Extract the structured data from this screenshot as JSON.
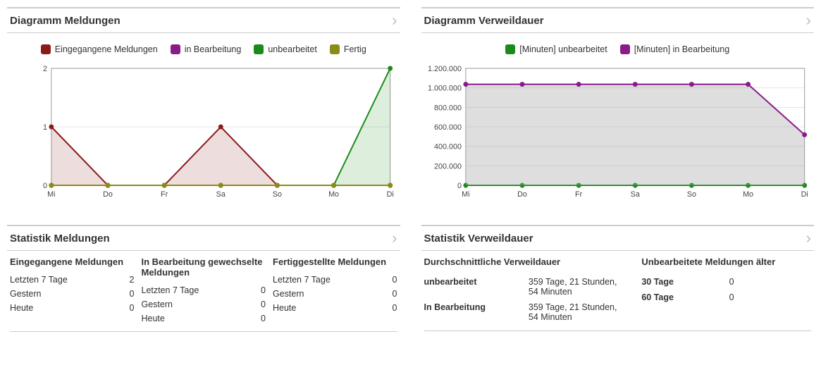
{
  "panels": {
    "chart_meldungen": {
      "title": "Diagramm Meldungen"
    },
    "chart_verweildauer": {
      "title": "Diagramm Verweildauer"
    },
    "stat_meldungen": {
      "title": "Statistik Meldungen"
    },
    "stat_verweildauer": {
      "title": "Statistik Verweildauer"
    }
  },
  "legend_meldungen": [
    {
      "label": "Eingegangene Meldungen",
      "color": "#8b1a1a"
    },
    {
      "label": "in Bearbeitung",
      "color": "#8b1a8b"
    },
    {
      "label": "unbearbeitet",
      "color": "#1a8b1a"
    },
    {
      "label": "Fertig",
      "color": "#8b8b1a"
    }
  ],
  "legend_verweildauer": [
    {
      "label": "[Minuten] unbearbeitet",
      "color": "#1a8b1a"
    },
    {
      "label": "[Minuten] in Bearbeitung",
      "color": "#8b1a8b"
    }
  ],
  "stats_meldungen": [
    {
      "heading": "Eingegangene Meldungen",
      "rows": [
        {
          "label": "Letzten 7 Tage",
          "value": "2"
        },
        {
          "label": "Gestern",
          "value": "0"
        },
        {
          "label": "Heute",
          "value": "0"
        }
      ]
    },
    {
      "heading": "In Bearbeitung gewechselte Meldungen",
      "rows": [
        {
          "label": "Letzten 7 Tage",
          "value": "0"
        },
        {
          "label": "Gestern",
          "value": "0"
        },
        {
          "label": "Heute",
          "value": "0"
        }
      ]
    },
    {
      "heading": "Fertiggestellte Meldungen",
      "rows": [
        {
          "label": "Letzten 7 Tage",
          "value": "0"
        },
        {
          "label": "Gestern",
          "value": "0"
        },
        {
          "label": "Heute",
          "value": "0"
        }
      ]
    }
  ],
  "stats_verweildauer": {
    "avg": {
      "heading": "Durchschnittliche Verweildauer",
      "rows": [
        {
          "label": "unbearbeitet",
          "value": "359 Tage, 21 Stunden, 54 Minuten"
        },
        {
          "label": "In Bearbeitung",
          "value": "359 Tage, 21 Stunden, 54 Minuten"
        }
      ]
    },
    "older": {
      "heading": "Unbearbeitete Meldungen älter",
      "rows": [
        {
          "label": "30 Tage",
          "value": "0"
        },
        {
          "label": "60 Tage",
          "value": "0"
        }
      ]
    }
  },
  "chart_data": [
    {
      "id": "meldungen",
      "type": "line",
      "categories": [
        "Mi",
        "Do",
        "Fr",
        "Sa",
        "So",
        "Mo",
        "Di"
      ],
      "ylim": [
        0,
        2
      ],
      "yticks": [
        0,
        1,
        2
      ],
      "series": [
        {
          "name": "Eingegangene Meldungen",
          "color": "#8b1a1a",
          "fill": "rgba(139,26,26,0.15)",
          "values": [
            1,
            0,
            0,
            1,
            0,
            0,
            0
          ]
        },
        {
          "name": "in Bearbeitung",
          "color": "#8b1a8b",
          "fill": "rgba(139,26,139,0.15)",
          "values": [
            0,
            0,
            0,
            0,
            0,
            0,
            0
          ]
        },
        {
          "name": "unbearbeitet",
          "color": "#1a8b1a",
          "fill": "rgba(26,139,26,0.15)",
          "values": [
            0,
            0,
            0,
            0,
            0,
            0,
            2
          ]
        },
        {
          "name": "Fertig",
          "color": "#8b8b1a",
          "fill": "rgba(139,139,26,0.15)",
          "values": [
            0,
            0,
            0,
            0,
            0,
            0,
            0
          ]
        }
      ]
    },
    {
      "id": "verweildauer",
      "type": "line",
      "categories": [
        "Mi",
        "Do",
        "Fr",
        "Sa",
        "So",
        "Mo",
        "Di"
      ],
      "ylim": [
        0,
        1200000
      ],
      "yticks": [
        0,
        200000,
        400000,
        600000,
        800000,
        1000000,
        1200000
      ],
      "series": [
        {
          "name": "[Minuten] unbearbeitet",
          "color": "#1a8b1a",
          "fill": "rgba(26,139,26,0.10)",
          "values": [
            0,
            0,
            0,
            0,
            0,
            0,
            0
          ]
        },
        {
          "name": "[Minuten] in Bearbeitung",
          "color": "#8b1a8b",
          "fill": "rgba(160,160,160,0.35)",
          "values": [
            1036674,
            1036674,
            1036674,
            1036674,
            1036674,
            1036674,
            518337
          ]
        }
      ]
    }
  ]
}
